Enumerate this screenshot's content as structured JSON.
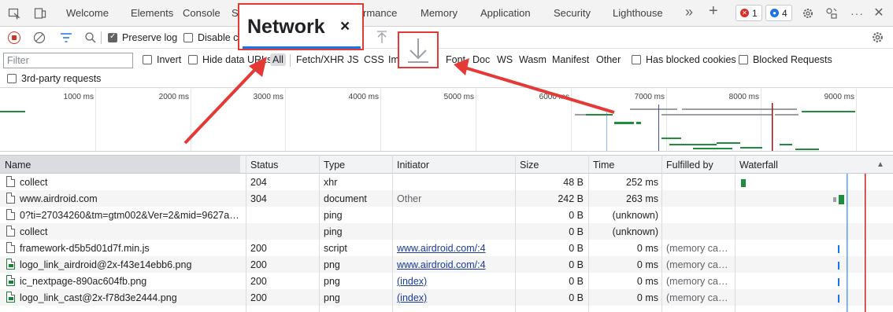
{
  "tabbar": {
    "tabs": [
      "Welcome",
      "Elements",
      "Console",
      "S",
      "rmance",
      "Memory",
      "Application",
      "Security",
      "Lighthouse"
    ],
    "more": "»",
    "add": "+",
    "error_count": "1",
    "info_count": "4",
    "colors": {
      "error": "#d93025",
      "info": "#1a73e8"
    }
  },
  "toolbar": {
    "preserve_log": "Preserve log",
    "disable_cache": "Disable ca"
  },
  "filter": {
    "placeholder": "Filter",
    "invert": "Invert",
    "hide_data_urls": "Hide data URLs",
    "types": [
      "All",
      "Fetch/XHR",
      "JS",
      "CSS",
      "Im",
      "Font",
      "Doc",
      "WS",
      "Wasm",
      "Manifest",
      "Other"
    ],
    "has_blocked_cookies": "Has blocked cookies",
    "blocked_requests": "Blocked Requests",
    "third_party": "3rd-party requests"
  },
  "overview": {
    "ticks": [
      "1000 ms",
      "2000 ms",
      "3000 ms",
      "4000 ms",
      "5000 ms",
      "6000 ms",
      "7000 ms",
      "8000 ms",
      "9000 ms"
    ]
  },
  "popup": {
    "title": "Network",
    "close": "×"
  },
  "table": {
    "headers": [
      "Name",
      "Status",
      "Type",
      "Initiator",
      "Size",
      "Time",
      "Fulfilled by",
      "Waterfall"
    ],
    "rows": [
      {
        "name": "collect",
        "status": "204",
        "type": "xhr",
        "initiator": "",
        "size": "48 B",
        "time": "252 ms",
        "fulfilled": "",
        "icon": "doc"
      },
      {
        "name": "www.airdroid.com",
        "status": "304",
        "type": "document",
        "initiator": "Other",
        "size": "242 B",
        "time": "263 ms",
        "fulfilled": "",
        "icon": "doc"
      },
      {
        "name": "0?ti=27034260&tm=gtm002&Ver=2&mid=9627a0...",
        "status": "",
        "type": "ping",
        "initiator": "",
        "size": "0 B",
        "time": "(unknown)",
        "fulfilled": "",
        "icon": "doc"
      },
      {
        "name": "collect",
        "status": "",
        "type": "ping",
        "initiator": "",
        "size": "0 B",
        "time": "(unknown)",
        "fulfilled": "",
        "icon": "doc"
      },
      {
        "name": "framework-d5b5d01d7f.min.js",
        "status": "200",
        "type": "script",
        "initiator": "www.airdroid.com/:4",
        "size": "0 B",
        "time": "0 ms",
        "fulfilled": "(memory cach...",
        "icon": "doc"
      },
      {
        "name": "logo_link_airdroid@2x-f43e14ebb6.png",
        "status": "200",
        "type": "png",
        "initiator": "www.airdroid.com/:4",
        "size": "0 B",
        "time": "0 ms",
        "fulfilled": "(memory cach...",
        "icon": "img"
      },
      {
        "name": "ic_nextpage-890ac604fb.png",
        "status": "200",
        "type": "png",
        "initiator": "(index)",
        "size": "0 B",
        "time": "0 ms",
        "fulfilled": "(memory cach...",
        "icon": "img"
      },
      {
        "name": "logo_link_cast@2x-f78d3e2444.png",
        "status": "200",
        "type": "png",
        "initiator": "(index)",
        "size": "0 B",
        "time": "0 ms",
        "fulfilled": "(memory cach...",
        "icon": "img"
      }
    ]
  },
  "accent_red": "#e53935"
}
